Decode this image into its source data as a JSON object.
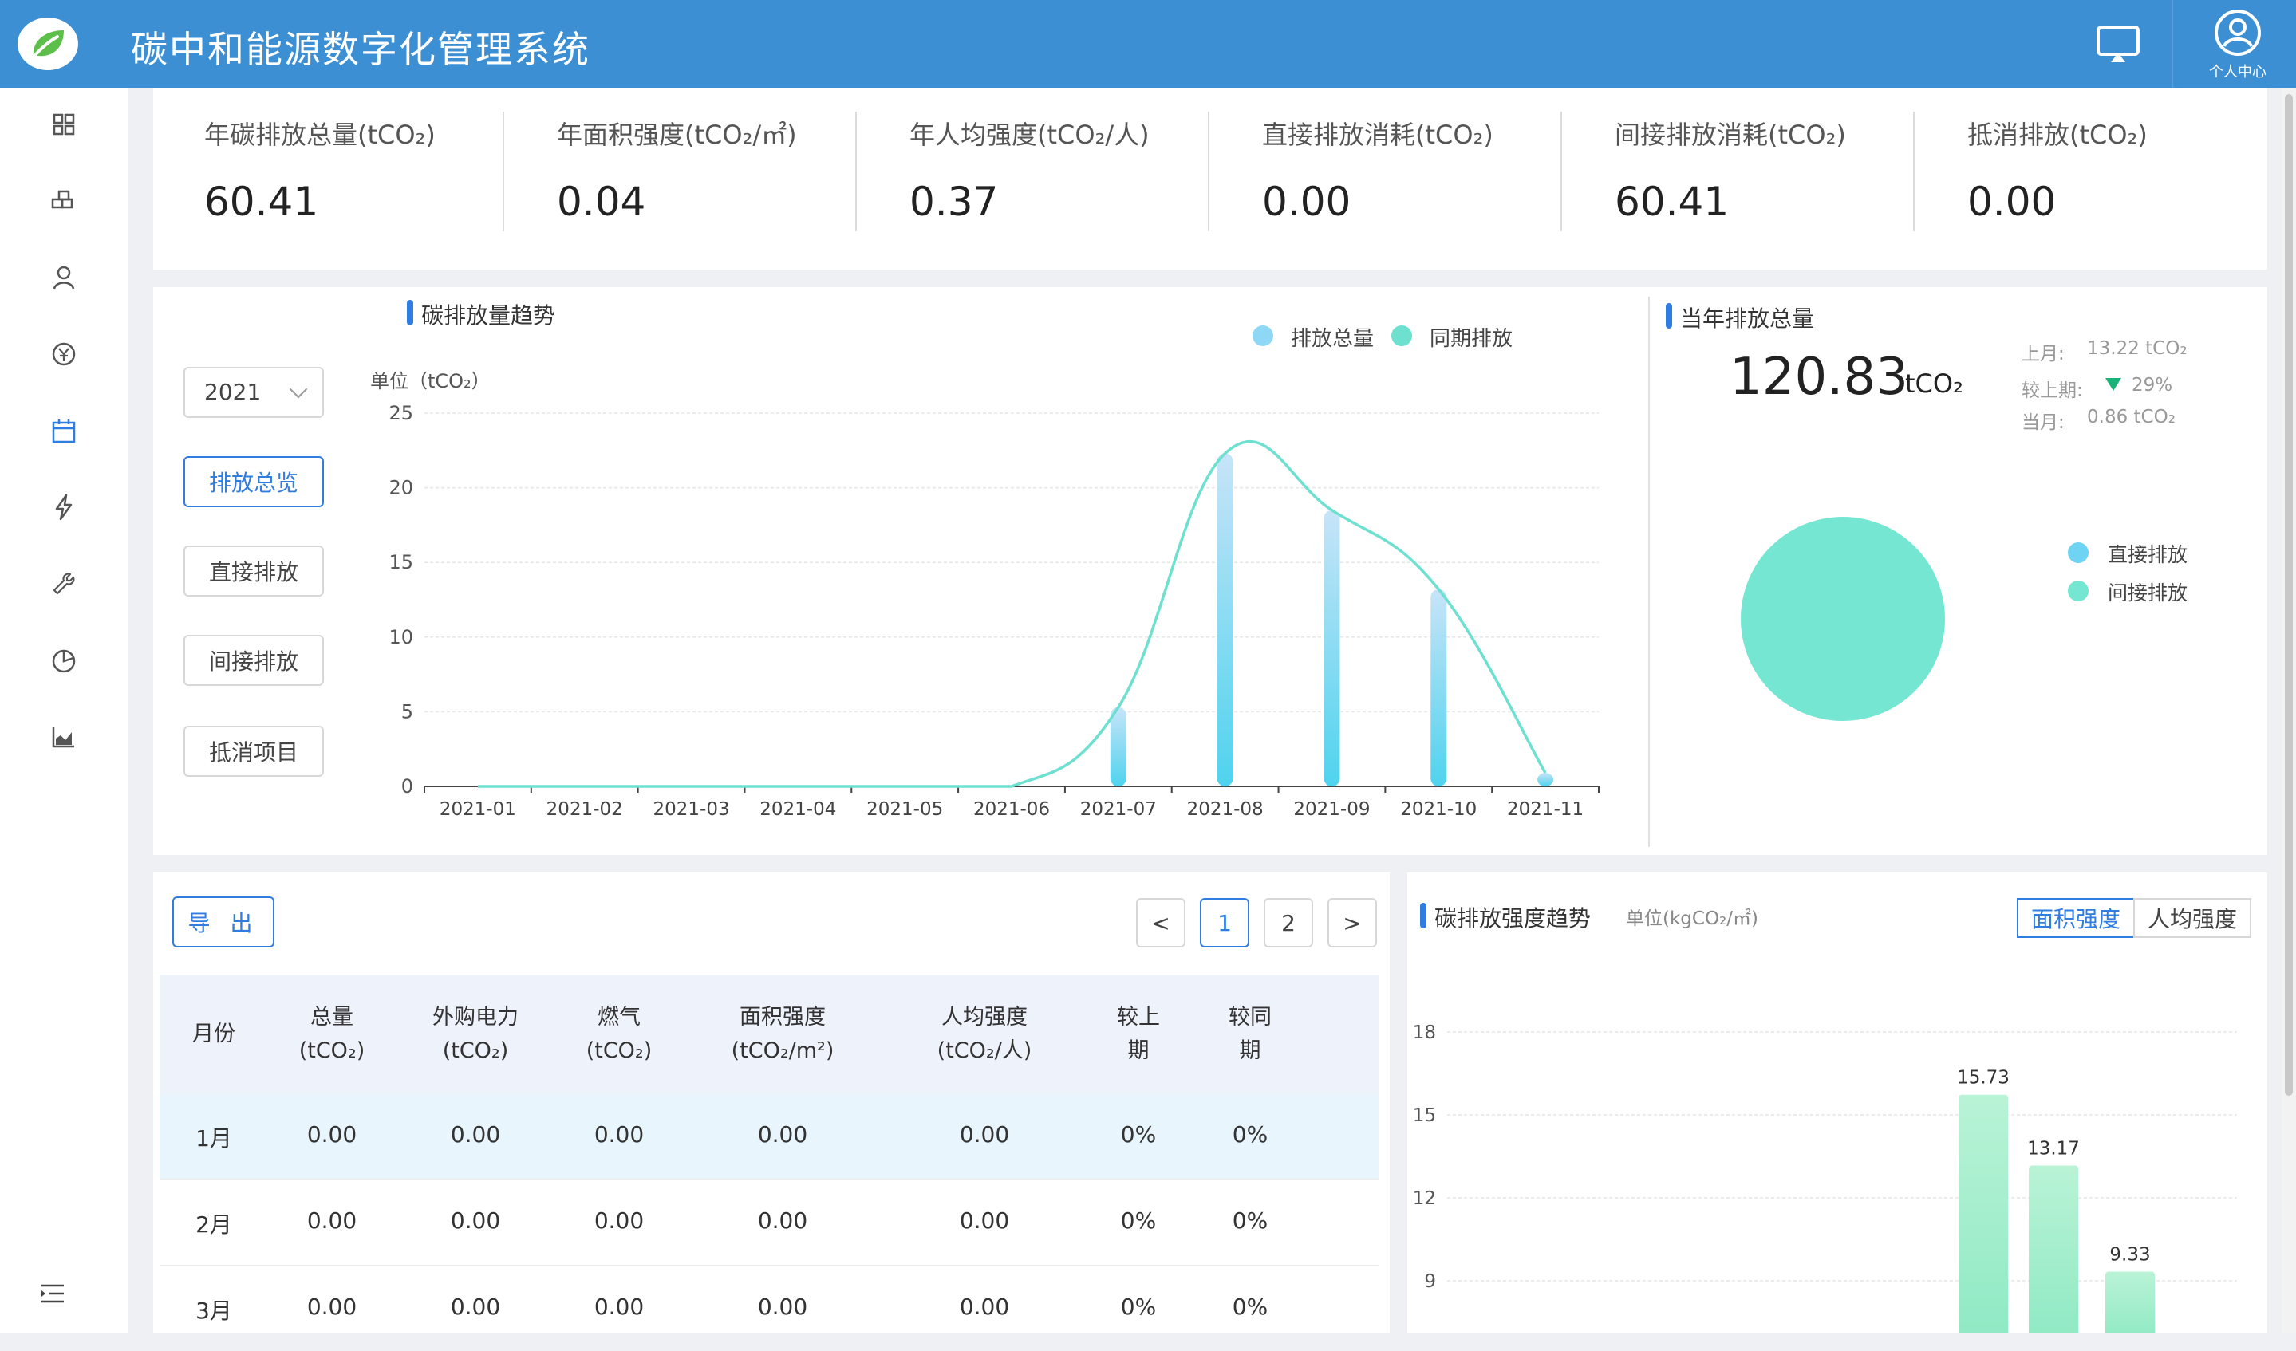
{
  "header": {
    "title": "碳中和能源数字化管理系统",
    "user_center": "个人中心"
  },
  "sidebar": {
    "items": [
      "dashboard-icon",
      "blocks-icon",
      "user-icon",
      "currency-icon",
      "calendar-icon",
      "bolt-icon",
      "wrench-icon",
      "pie-chart-icon",
      "bar-chart-icon"
    ],
    "collapse": "menu-collapse-icon"
  },
  "stats": [
    {
      "label": "年碳排放总量(tCO₂)",
      "value": "60.41"
    },
    {
      "label": "年面积强度(tCO₂/㎡)",
      "value": "0.04"
    },
    {
      "label": "年人均强度(tCO₂/人)",
      "value": "0.37"
    },
    {
      "label": "直接排放消耗(tCO₂)",
      "value": "0.00"
    },
    {
      "label": "间接排放消耗(tCO₂)",
      "value": "60.41"
    },
    {
      "label": "抵消排放(tCO₂)",
      "value": "0.00"
    }
  ],
  "trend": {
    "title": "碳排放量趋势",
    "year": "2021",
    "buttons": [
      "排放总览",
      "直接排放",
      "间接排放",
      "抵消项目"
    ],
    "legend": [
      "排放总量",
      "同期排放"
    ],
    "unit": "单位（tCO₂）"
  },
  "annual": {
    "title": "当年排放总量",
    "value": "120.83",
    "unit": "tCO₂",
    "last_month_label": "上月:",
    "last_month_value": "13.22 tCO₂",
    "vs_prev_label": "较上期:",
    "vs_prev_value": "29%",
    "this_month_label": "当月:",
    "this_month_value": "0.86 tCO₂",
    "legend": [
      "直接排放",
      "间接排放"
    ]
  },
  "table": {
    "export_label": "导 出",
    "pager": {
      "prev": "<",
      "pages": [
        "1",
        "2"
      ],
      "next": ">"
    },
    "headers": [
      [
        "月份"
      ],
      [
        "总量",
        "(tCO₂)"
      ],
      [
        "外购电力",
        "(tCO₂)"
      ],
      [
        "燃气",
        "(tCO₂)"
      ],
      [
        "面积强度",
        "(tCO₂/m²)"
      ],
      [
        "人均强度",
        "(tCO₂/人)"
      ],
      [
        "较上",
        "期"
      ],
      [
        "较同",
        "期"
      ]
    ],
    "rows": [
      [
        "1月",
        "0.00",
        "0.00",
        "0.00",
        "0.00",
        "0.00",
        "0%",
        "0%"
      ],
      [
        "2月",
        "0.00",
        "0.00",
        "0.00",
        "0.00",
        "0.00",
        "0%",
        "0%"
      ],
      [
        "3月",
        "0.00",
        "0.00",
        "0.00",
        "0.00",
        "0.00",
        "0%",
        "0%"
      ]
    ]
  },
  "intensity": {
    "title": "碳排放强度趋势",
    "unit": "单位(kgCO₂/㎡)",
    "tabs": [
      "面积强度",
      "人均强度"
    ]
  },
  "colors": {
    "header_bg": "#3d8fd3",
    "accent": "#2f7de1",
    "bar_blue": "#5fd0f0",
    "line_teal": "#6ee0d0",
    "pie_teal": "#74e6d2",
    "bar_green": "#9ff0c8",
    "down_green": "#19b37a"
  },
  "chart_data": [
    {
      "type": "bar",
      "categories": [
        "2021-01",
        "2021-02",
        "2021-03",
        "2021-04",
        "2021-05",
        "2021-06",
        "2021-07",
        "2021-08",
        "2021-09",
        "2021-10",
        "2021-11"
      ],
      "series": [
        {
          "name": "排放总量",
          "type": "bar",
          "values": [
            0,
            0,
            0,
            0,
            0,
            0,
            5.3,
            22.3,
            18.5,
            13.2,
            0.9
          ]
        },
        {
          "name": "同期排放",
          "type": "line",
          "values": [
            0,
            0,
            0,
            0,
            0,
            0,
            5.3,
            22.3,
            18.5,
            13.2,
            0.9
          ]
        }
      ],
      "ylim": [
        0,
        25
      ],
      "yticks": [
        0,
        5,
        10,
        15,
        20,
        25
      ],
      "ylabel": "单位（tCO₂）",
      "grid": true,
      "legend": "top-right"
    },
    {
      "type": "pie",
      "labels": [
        "直接排放",
        "间接排放"
      ],
      "values": [
        0,
        120.83
      ],
      "legend": "right"
    },
    {
      "type": "bar",
      "values_visible": [
        15.73,
        13.17,
        9.33
      ],
      "data_labels": [
        "15.73",
        "13.17",
        "9.33"
      ],
      "yticks": [
        9,
        12,
        15,
        18
      ],
      "ylabel": "单位(kgCO₂/㎡)",
      "grid": true
    }
  ]
}
